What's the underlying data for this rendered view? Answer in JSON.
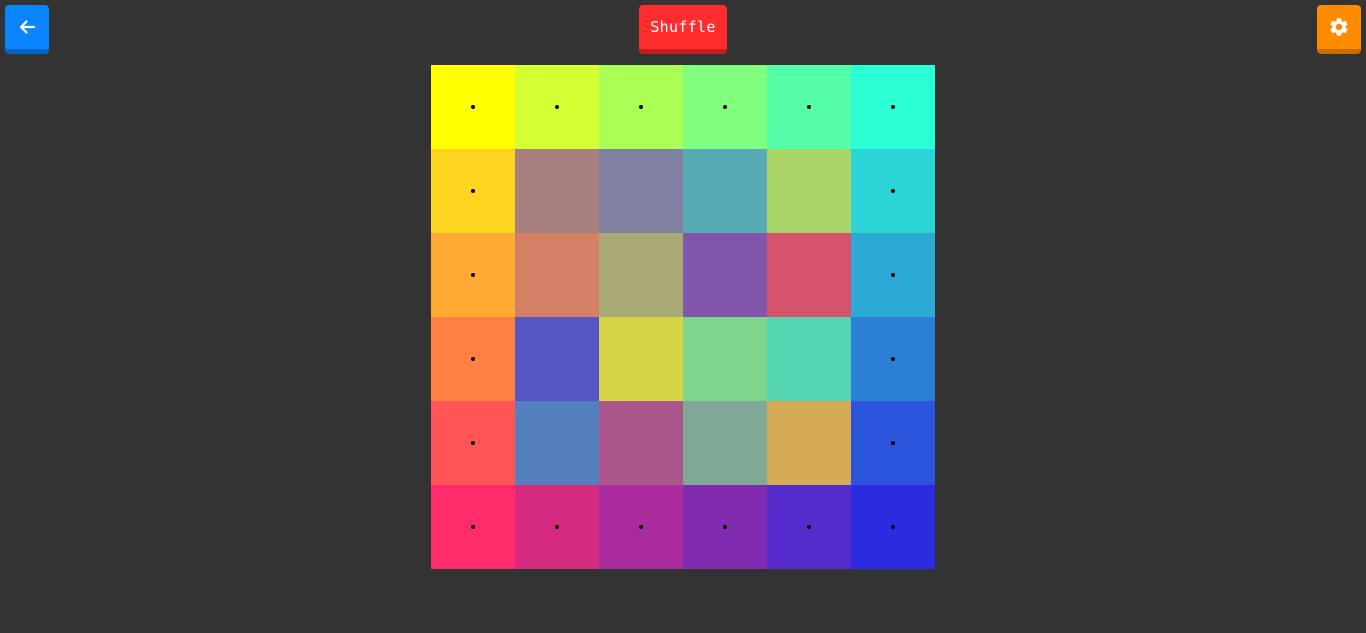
{
  "toolbar": {
    "back_icon": "arrow-left-icon",
    "shuffle_label": "Shuffle",
    "settings_icon": "gear-icon",
    "colors": {
      "back": "#0a84ff",
      "shuffle": "#ff2d2d",
      "settings": "#ff8c00",
      "background": "#333333"
    }
  },
  "board": {
    "rows": 6,
    "cols": 6,
    "tiles": [
      [
        {
          "color": "#ffff00",
          "locked": true
        },
        {
          "color": "#d4ff33",
          "locked": true
        },
        {
          "color": "#aaff55",
          "locked": true
        },
        {
          "color": "#80ff7f",
          "locked": true
        },
        {
          "color": "#55ffaa",
          "locked": true
        },
        {
          "color": "#2bffd5",
          "locked": true
        }
      ],
      [
        {
          "color": "#ffd41e",
          "locked": true
        },
        {
          "color": "#a88080",
          "locked": false
        },
        {
          "color": "#8080a0",
          "locked": false
        },
        {
          "color": "#55aab4",
          "locked": false
        },
        {
          "color": "#aad466",
          "locked": false
        },
        {
          "color": "#2bd4d5",
          "locked": true
        }
      ],
      [
        {
          "color": "#ffaa33",
          "locked": true
        },
        {
          "color": "#d48066",
          "locked": false
        },
        {
          "color": "#aaaa77",
          "locked": false
        },
        {
          "color": "#8055aa",
          "locked": false
        },
        {
          "color": "#d4556b",
          "locked": false
        },
        {
          "color": "#2baad5",
          "locked": true
        }
      ],
      [
        {
          "color": "#ff8040",
          "locked": true
        },
        {
          "color": "#5555c4",
          "locked": false
        },
        {
          "color": "#d4d544",
          "locked": false
        },
        {
          "color": "#80d58c",
          "locked": false
        },
        {
          "color": "#55d4b2",
          "locked": false
        },
        {
          "color": "#2b80d5",
          "locked": true
        }
      ],
      [
        {
          "color": "#ff5555",
          "locked": true
        },
        {
          "color": "#5580bf",
          "locked": false
        },
        {
          "color": "#aa558c",
          "locked": false
        },
        {
          "color": "#80aa95",
          "locked": false
        },
        {
          "color": "#d4aa55",
          "locked": false
        },
        {
          "color": "#2b55dd",
          "locked": true
        }
      ],
      [
        {
          "color": "#ff2b6b",
          "locked": true
        },
        {
          "color": "#d42b80",
          "locked": true
        },
        {
          "color": "#aa2b9b",
          "locked": true
        },
        {
          "color": "#802bb0",
          "locked": true
        },
        {
          "color": "#552bc9",
          "locked": true
        },
        {
          "color": "#2b2be0",
          "locked": true
        }
      ]
    ]
  }
}
